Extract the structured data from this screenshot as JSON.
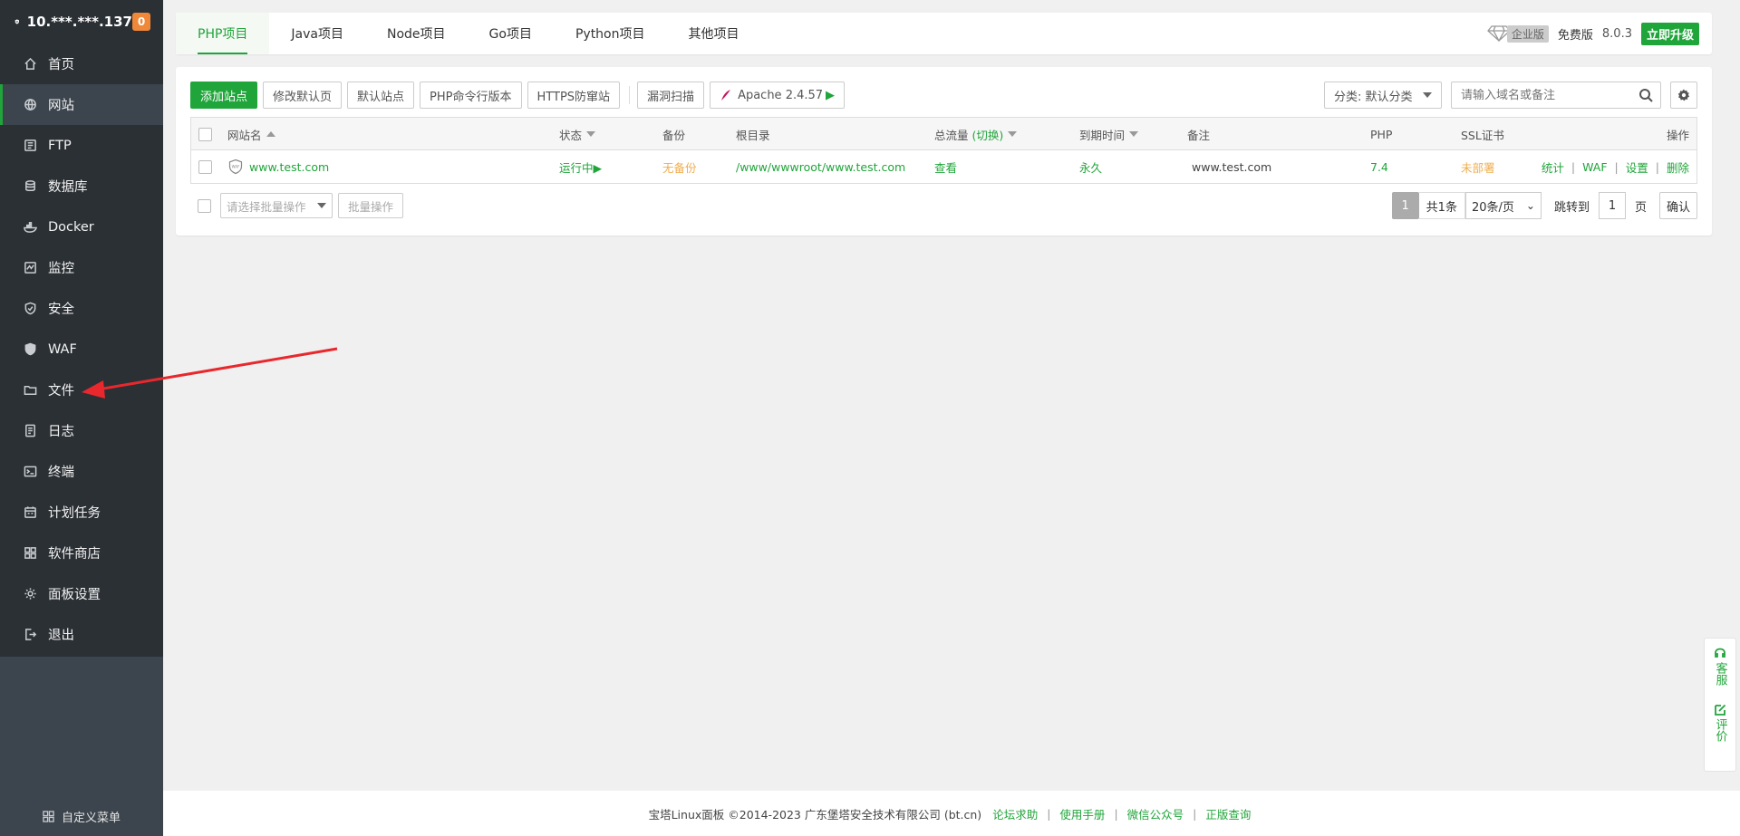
{
  "sidebar": {
    "server_ip": "10.***.***.137",
    "badge_count": "0",
    "items": [
      {
        "label": "首页",
        "icon": "home-icon"
      },
      {
        "label": "网站",
        "icon": "globe-icon"
      },
      {
        "label": "FTP",
        "icon": "ftp-icon"
      },
      {
        "label": "数据库",
        "icon": "database-icon"
      },
      {
        "label": "Docker",
        "icon": "docker-icon"
      },
      {
        "label": "监控",
        "icon": "monitor-icon"
      },
      {
        "label": "安全",
        "icon": "shield-icon"
      },
      {
        "label": "WAF",
        "icon": "waf-icon"
      },
      {
        "label": "文件",
        "icon": "folder-icon"
      },
      {
        "label": "日志",
        "icon": "log-icon"
      },
      {
        "label": "终端",
        "icon": "terminal-icon"
      },
      {
        "label": "计划任务",
        "icon": "calendar-icon"
      },
      {
        "label": "软件商店",
        "icon": "apps-icon"
      },
      {
        "label": "面板设置",
        "icon": "gear-icon"
      },
      {
        "label": "退出",
        "icon": "logout-icon"
      }
    ],
    "custom_menu": "自定义菜单"
  },
  "tabs": [
    "PHP项目",
    "Java项目",
    "Node项目",
    "Go项目",
    "Python项目",
    "其他项目"
  ],
  "topright": {
    "enterprise": "企业版",
    "free": "免费版",
    "version": "8.0.3",
    "upgrade": "立即升级"
  },
  "toolbar": {
    "add_site": "添加站点",
    "edit_default": "修改默认页",
    "default_site": "默认站点",
    "php_cli": "PHP命令行版本",
    "https_guard": "HTTPS防窜站",
    "vuln_scan": "漏洞扫描",
    "apache": "Apache 2.4.57",
    "category": "分类: 默认分类",
    "search_placeholder": "请输入域名或备注"
  },
  "table": {
    "headers": {
      "name": "网站名",
      "status": "状态",
      "backup": "备份",
      "root": "根目录",
      "traffic": "总流量",
      "traffic_switch": "(切换)",
      "expire": "到期时间",
      "remark": "备注",
      "php": "PHP",
      "ssl": "SSL证书",
      "ops": "操作"
    },
    "rows": [
      {
        "name": "www.test.com",
        "status": "运行中▶",
        "backup": "无备份",
        "root": "/www/wwwroot/www.test.com",
        "traffic": "查看",
        "expire": "永久",
        "remark": "www.test.com",
        "php": "7.4",
        "ssl": "未部署",
        "ops": [
          "统计",
          "WAF",
          "设置",
          "删除"
        ]
      }
    ]
  },
  "pager": {
    "batch_placeholder": "请选择批量操作",
    "batch_btn": "批量操作",
    "current": "1",
    "total": "共1条",
    "page_size": "20条/页",
    "jump_label": "跳转到",
    "jump_value": "1",
    "page_unit": "页",
    "confirm": "确认"
  },
  "footer": {
    "copyright": "宝塔Linux面板 ©2014-2023 广东堡塔安全技术有限公司 (bt.cn)",
    "links": [
      "论坛求助",
      "使用手册",
      "微信公众号",
      "正版查询"
    ]
  },
  "float": {
    "service": "客服",
    "rate": "评价"
  },
  "colors": {
    "accent": "#20a53a",
    "sidebar": "#2b3035",
    "warning": "#f0ad4e",
    "arrow": "#e8282d"
  }
}
